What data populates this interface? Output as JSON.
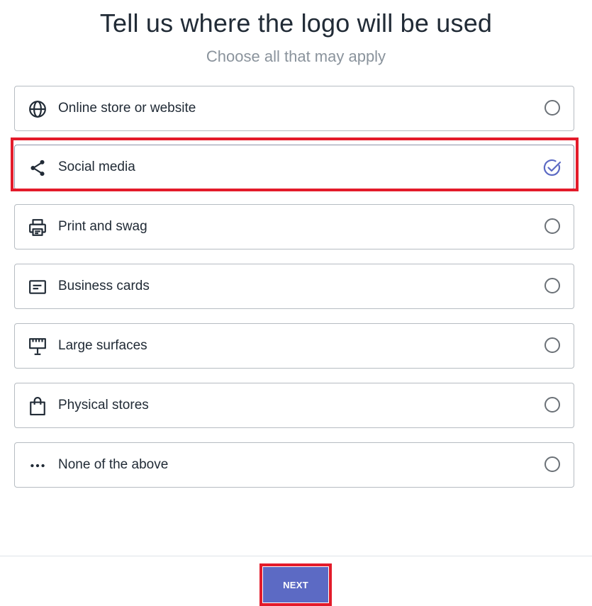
{
  "header": {
    "title": "Tell us where the logo will be used",
    "subtitle": "Choose all that may apply"
  },
  "options": [
    {
      "label": "Online store or website",
      "icon": "globe-icon",
      "selected": false
    },
    {
      "label": "Social media",
      "icon": "share-icon",
      "selected": true
    },
    {
      "label": "Print and swag",
      "icon": "printer-icon",
      "selected": false
    },
    {
      "label": "Business cards",
      "icon": "business-card-icon",
      "selected": false
    },
    {
      "label": "Large surfaces",
      "icon": "billboard-icon",
      "selected": false
    },
    {
      "label": "Physical stores",
      "icon": "shopping-bag-icon",
      "selected": false
    },
    {
      "label": "None of the above",
      "icon": "more-horizontal-icon",
      "selected": false
    }
  ],
  "footer": {
    "next_label": "NEXT"
  },
  "colors": {
    "accent": "#5c6ac4",
    "highlight": "#e31b2a",
    "text": "#212b36",
    "muted": "#8a939c",
    "border": "#b6bcc2"
  }
}
